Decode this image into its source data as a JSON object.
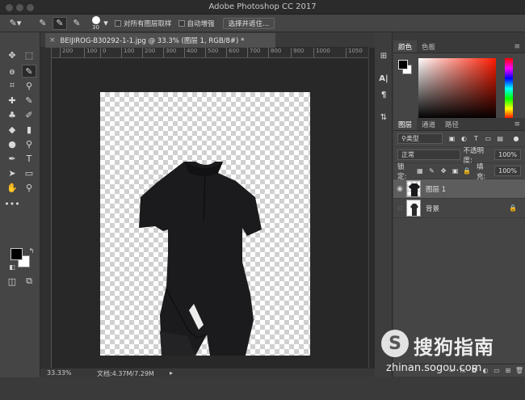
{
  "app": {
    "title": "Adobe Photoshop CC 2017"
  },
  "options_bar": {
    "brush_size": "30",
    "sample_all_layers": "对所有图层取样",
    "auto_enhance": "自动增强",
    "select_and_mask": "选择并遮住..."
  },
  "document": {
    "tab_title": "BEIJIROG-B30292-1-1.jpg @ 33.3% (图层 1, RGB/8#) *",
    "ruler_ticks": [
      "200",
      "100",
      "0",
      "100",
      "200",
      "300",
      "400",
      "500",
      "600",
      "700",
      "800",
      "900",
      "1000",
      "1050"
    ]
  },
  "status": {
    "zoom": "33.33%",
    "doc_info": "文档:4.37M/7.29M"
  },
  "color_panel": {
    "tabs": [
      "颜色",
      "色板"
    ]
  },
  "layers_panel": {
    "tabs": [
      "图层",
      "通道",
      "路径"
    ],
    "filter_kind": "类型",
    "blend_mode": "正常",
    "opacity_label": "不透明度:",
    "opacity_value": "100%",
    "lock_label": "锁定:",
    "fill_label": "填充:",
    "fill_value": "100%",
    "layers": [
      {
        "name": "图层 1",
        "active": true
      },
      {
        "name": "背景",
        "active": false
      }
    ]
  },
  "watermark": {
    "name": "搜狗指南",
    "url": "zhinan.sogou.com"
  },
  "colors": {
    "accent": "#5d5d5d",
    "panel": "#454545",
    "canvas": "#282828"
  }
}
